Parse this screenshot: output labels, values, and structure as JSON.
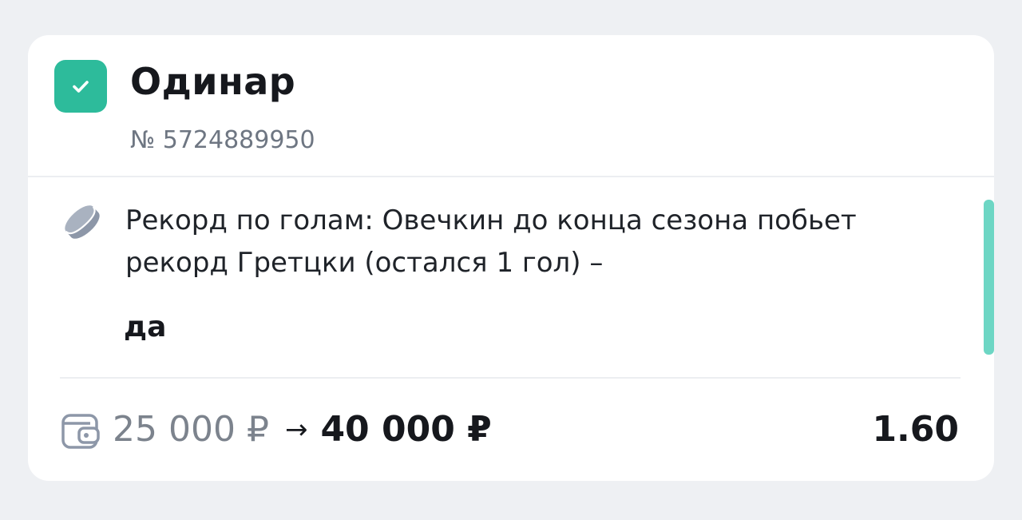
{
  "colors": {
    "accent": "#2dbb9b",
    "scroll_indicator": "#6dd6c4",
    "icon_gray": "#8d97a8"
  },
  "bet": {
    "checked": true,
    "type": "Одинар",
    "number": "№ 5724889950"
  },
  "outcome": {
    "icon": "hockey-puck-icon",
    "text": "Рекорд по голам: Овечкин до конца сезона побьет рекорд Гретцки (остался 1 гол) –",
    "result": "да"
  },
  "footer": {
    "icon": "wallet-icon",
    "stake": "25 000 ₽",
    "arrow": "→",
    "payout": "40 000 ₽",
    "odds": "1.60"
  }
}
